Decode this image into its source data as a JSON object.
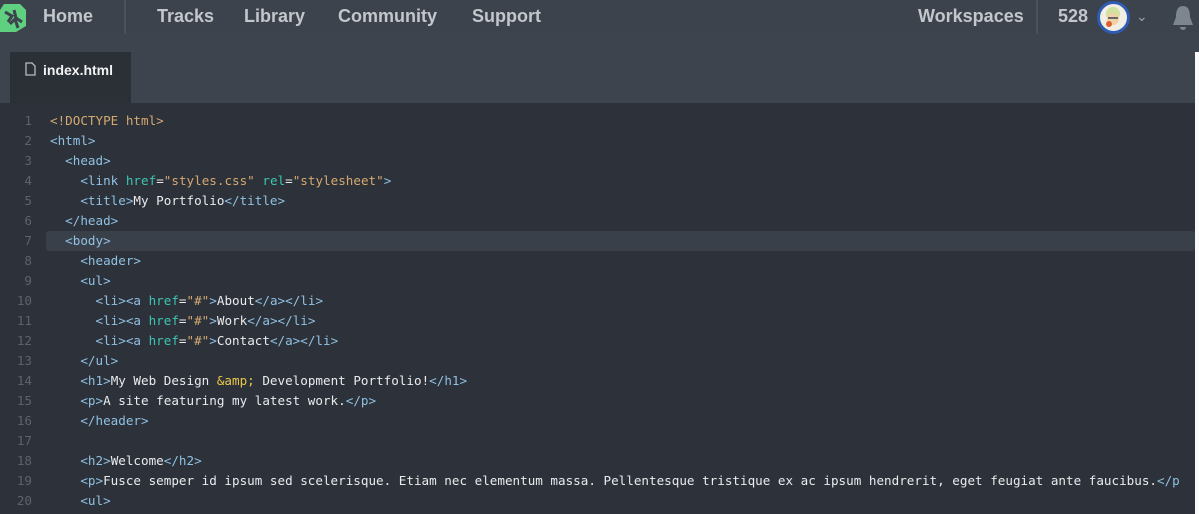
{
  "nav": {
    "home": "Home",
    "items": [
      "Tracks",
      "Library",
      "Community",
      "Support"
    ],
    "workspaces": "Workspaces",
    "points": "528"
  },
  "icons": {
    "logo": "treehouse-logo",
    "avatar": "user-avatar",
    "chevron": "chevron-down-icon",
    "bell": "bell-icon",
    "file": "file-icon"
  },
  "tab": {
    "label": "index.html"
  },
  "editor": {
    "highlighted_line": 7,
    "lines": [
      [
        [
          "doc",
          "<!DOCTYPE html>"
        ]
      ],
      [
        [
          "tag",
          "<html>"
        ]
      ],
      [
        [
          "txt",
          "  "
        ],
        [
          "tag",
          "<head>"
        ]
      ],
      [
        [
          "txt",
          "    "
        ],
        [
          "tag",
          "<link "
        ],
        [
          "attr",
          "href"
        ],
        [
          "txt",
          "="
        ],
        [
          "str",
          "\"styles.css\""
        ],
        [
          "txt",
          " "
        ],
        [
          "attr",
          "rel"
        ],
        [
          "txt",
          "="
        ],
        [
          "str",
          "\"stylesheet\""
        ],
        [
          "tag",
          ">"
        ]
      ],
      [
        [
          "txt",
          "    "
        ],
        [
          "tag",
          "<title>"
        ],
        [
          "txt",
          "My Portfolio"
        ],
        [
          "tag",
          "</title>"
        ]
      ],
      [
        [
          "txt",
          "  "
        ],
        [
          "tag",
          "</head>"
        ]
      ],
      [
        [
          "txt",
          "  "
        ],
        [
          "tag",
          "<body>"
        ]
      ],
      [
        [
          "txt",
          "    "
        ],
        [
          "tag",
          "<header>"
        ]
      ],
      [
        [
          "txt",
          "    "
        ],
        [
          "tag",
          "<ul>"
        ]
      ],
      [
        [
          "txt",
          "      "
        ],
        [
          "tag",
          "<li><a "
        ],
        [
          "attr",
          "href"
        ],
        [
          "txt",
          "="
        ],
        [
          "str",
          "\"#\""
        ],
        [
          "tag",
          ">"
        ],
        [
          "txt",
          "About"
        ],
        [
          "tag",
          "</a></li>"
        ]
      ],
      [
        [
          "txt",
          "      "
        ],
        [
          "tag",
          "<li><a "
        ],
        [
          "attr",
          "href"
        ],
        [
          "txt",
          "="
        ],
        [
          "str",
          "\"#\""
        ],
        [
          "tag",
          ">"
        ],
        [
          "txt",
          "Work"
        ],
        [
          "tag",
          "</a></li>"
        ]
      ],
      [
        [
          "txt",
          "      "
        ],
        [
          "tag",
          "<li><a "
        ],
        [
          "attr",
          "href"
        ],
        [
          "txt",
          "="
        ],
        [
          "str",
          "\"#\""
        ],
        [
          "tag",
          ">"
        ],
        [
          "txt",
          "Contact"
        ],
        [
          "tag",
          "</a></li>"
        ]
      ],
      [
        [
          "txt",
          "    "
        ],
        [
          "tag",
          "</ul>"
        ]
      ],
      [
        [
          "txt",
          "    "
        ],
        [
          "tag",
          "<h1>"
        ],
        [
          "txt",
          "My Web Design "
        ],
        [
          "ent",
          "&amp;"
        ],
        [
          "txt",
          " Development Portfolio!"
        ],
        [
          "tag",
          "</h1>"
        ]
      ],
      [
        [
          "txt",
          "    "
        ],
        [
          "tag",
          "<p>"
        ],
        [
          "txt",
          "A site featuring my latest work."
        ],
        [
          "tag",
          "</p>"
        ]
      ],
      [
        [
          "txt",
          "    "
        ],
        [
          "tag",
          "</header>"
        ]
      ],
      [],
      [
        [
          "txt",
          "    "
        ],
        [
          "tag",
          "<h2>"
        ],
        [
          "txt",
          "Welcome"
        ],
        [
          "tag",
          "</h2>"
        ]
      ],
      [
        [
          "txt",
          "    "
        ],
        [
          "tag",
          "<p>"
        ],
        [
          "txt",
          "Fusce semper id ipsum sed scelerisque. Etiam nec elementum massa. Pellentesque tristique ex ac ipsum hendrerit, eget feugiat ante faucibus."
        ],
        [
          "tag",
          "</p"
        ]
      ],
      [
        [
          "txt",
          "    "
        ],
        [
          "tag",
          "<ul>"
        ]
      ]
    ]
  }
}
